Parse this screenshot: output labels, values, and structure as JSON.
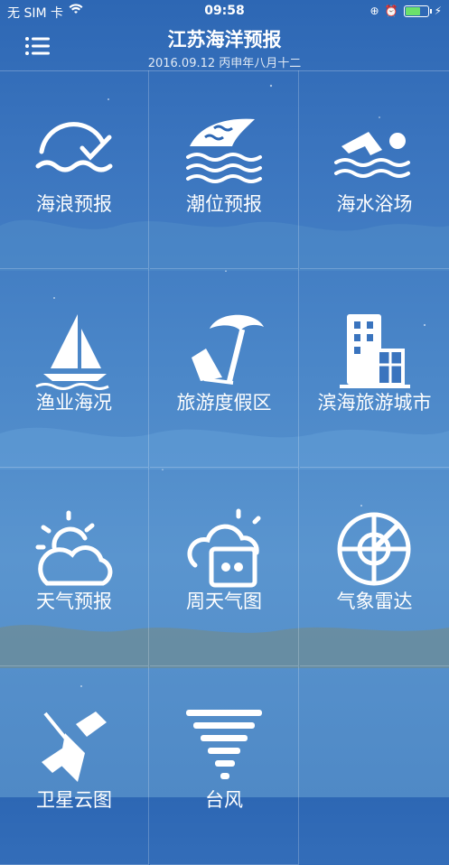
{
  "status": {
    "carrier": "无 SIM 卡",
    "time": "09:58",
    "battery_level": 0.75
  },
  "header": {
    "title": "江苏海洋预报",
    "date": "2016.09.12 丙申年八月十二"
  },
  "tiles": [
    {
      "label": "海浪预报",
      "icon": "wave-sun-icon"
    },
    {
      "label": "潮位预报",
      "icon": "tide-icon"
    },
    {
      "label": "海水浴场",
      "icon": "swimmer-icon"
    },
    {
      "label": "渔业海况",
      "icon": "sailboat-icon"
    },
    {
      "label": "旅游度假区",
      "icon": "beach-umbrella-icon"
    },
    {
      "label": "滨海旅游城市",
      "icon": "building-icon"
    },
    {
      "label": "天气预报",
      "icon": "sun-cloud-icon"
    },
    {
      "label": "周天气图",
      "icon": "weather-map-icon"
    },
    {
      "label": "气象雷达",
      "icon": "radar-icon"
    },
    {
      "label": "卫星云图",
      "icon": "satellite-icon"
    },
    {
      "label": "台风",
      "icon": "typhoon-icon"
    }
  ],
  "colors": {
    "background": "#3a74be",
    "accent": "#ffffff",
    "battery": "#6be06b"
  }
}
